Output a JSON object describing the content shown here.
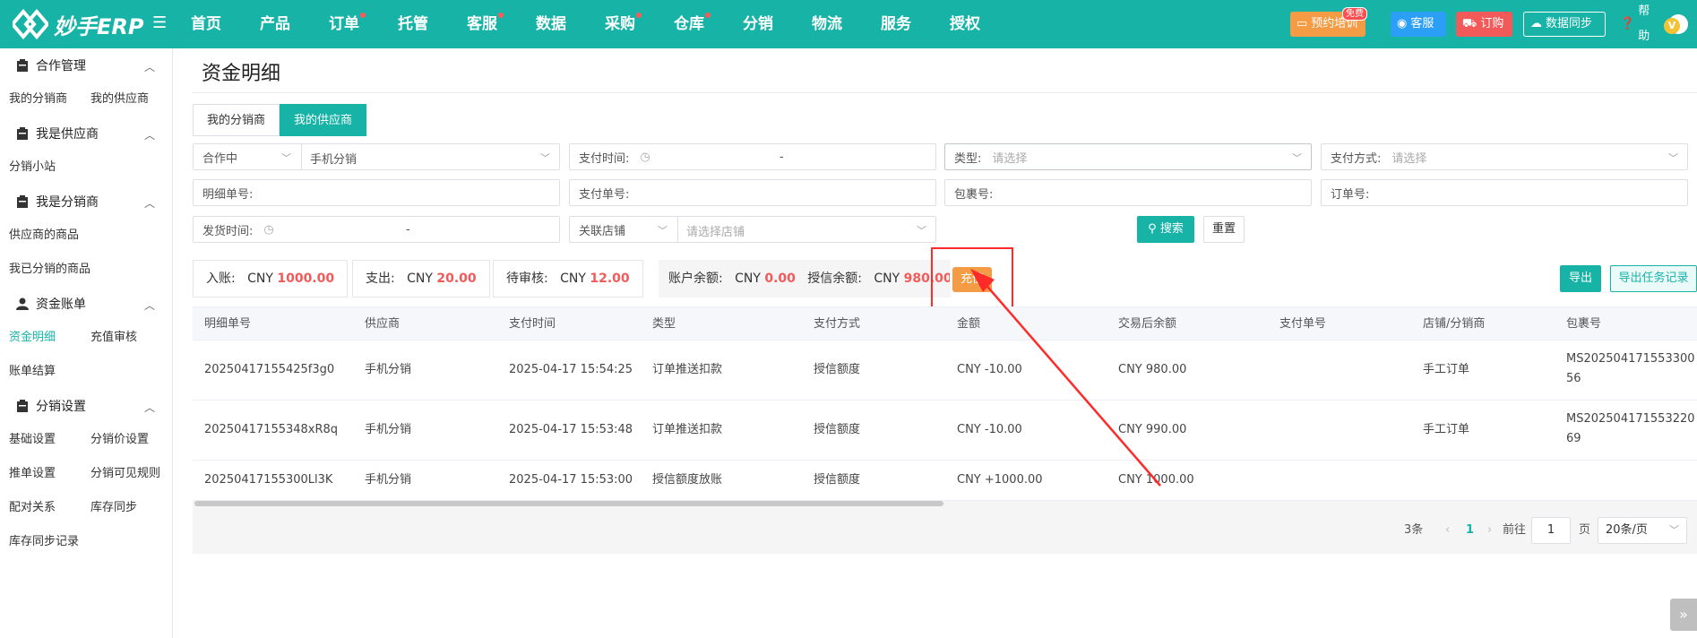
{
  "app": {
    "logo_text": "妙手ERP",
    "nav": [
      {
        "label": "首页",
        "dot": false
      },
      {
        "label": "产品",
        "dot": false
      },
      {
        "label": "订单",
        "dot": true
      },
      {
        "label": "托管",
        "dot": false
      },
      {
        "label": "客服",
        "dot": true
      },
      {
        "label": "数据",
        "dot": false
      },
      {
        "label": "采购",
        "dot": true
      },
      {
        "label": "仓库",
        "dot": true
      },
      {
        "label": "分销",
        "dot": false
      },
      {
        "label": "物流",
        "dot": false
      },
      {
        "label": "服务",
        "dot": false
      },
      {
        "label": "授权",
        "dot": false
      }
    ],
    "topbar_buttons": {
      "yuyue": "预约培训",
      "yuyue_badge": "免费",
      "kefu": "客服",
      "dinggou": "订购",
      "sync": "数据同步",
      "help": "帮助"
    },
    "avatar_letter": "V",
    "colors": {
      "brand": "#17b3a7",
      "accent_red": "#f25a5a",
      "orange": "#f39c45",
      "blue": "#2b9ef5"
    }
  },
  "sidebar": {
    "groups": [
      {
        "title": "合作管理",
        "links": [
          "我的分销商",
          "我的供应商"
        ]
      },
      {
        "title": "我是供应商",
        "links": [
          "分销小站"
        ]
      },
      {
        "title": "我是分销商",
        "links": [
          "供应商的商品",
          "我已分销的商品"
        ]
      },
      {
        "title": "资金账单",
        "links": [
          "资金明细",
          "充值审核",
          "账单结算"
        ]
      },
      {
        "title": "分销设置",
        "links": [
          "基础设置",
          "分销价设置",
          "推单设置",
          "分销可见规则",
          "配对关系",
          "库存同步",
          "库存同步记录"
        ]
      }
    ],
    "active_link": "资金明细"
  },
  "page": {
    "title": "资金明细",
    "tabs": [
      {
        "label": "我的分销商",
        "active": false
      },
      {
        "label": "我的供应商",
        "active": true
      }
    ]
  },
  "filters": {
    "status_select": "合作中",
    "partner_select": "手机分销",
    "pay_time_label": "支付时间:",
    "range_sep": "-",
    "type_label": "类型:",
    "type_placeholder": "请选择",
    "pay_method_label": "支付方式:",
    "pay_method_placeholder": "请选择",
    "detail_no_label": "明细单号:",
    "pay_no_label": "支付单号:",
    "package_no_label": "包裹号:",
    "order_no_label": "订单号:",
    "ship_time_label": "发货时间:",
    "shop_select": "关联店铺",
    "shop_placeholder": "请选择店铺",
    "search_label": "搜索",
    "reset_label": "重置"
  },
  "summary": {
    "income_label": "入账:",
    "income_currency": "CNY",
    "income_value": "1000.00",
    "expense_label": "支出:",
    "expense_currency": "CNY",
    "expense_value": "20.00",
    "pending_label": "待审核:",
    "pending_currency": "CNY",
    "pending_value": "12.00",
    "balance_label": "账户余额:",
    "balance_currency": "CNY",
    "balance_value": "0.00",
    "credit_label": "授信余额:",
    "credit_currency": "CNY",
    "credit_value": "980.00",
    "recharge_label": "充值",
    "export_label": "导出",
    "export_task_label": "导出任务记录"
  },
  "table": {
    "headers": [
      "明细单号",
      "供应商",
      "支付时间",
      "类型",
      "支付方式",
      "金额",
      "交易后余额",
      "支付单号",
      "店铺/分销商",
      "包裹号"
    ],
    "rows": [
      {
        "detail_no": "20250417155425f3g0",
        "supplier": "手机分销",
        "pay_time": "2025-04-17 15:54:25",
        "type": "订单推送扣款",
        "pay_method": "授信额度",
        "amount": "CNY -10.00",
        "balance_after": "CNY 980.00",
        "pay_no": "",
        "shop": "手工订单",
        "package_line1": "MS202504171553300",
        "package_line2": "56"
      },
      {
        "detail_no": "20250417155348xR8q",
        "supplier": "手机分销",
        "pay_time": "2025-04-17 15:53:48",
        "type": "订单推送扣款",
        "pay_method": "授信额度",
        "amount": "CNY -10.00",
        "balance_after": "CNY 990.00",
        "pay_no": "",
        "shop": "手工订单",
        "package_line1": "MS202504171553220",
        "package_line2": "69"
      },
      {
        "detail_no": "20250417155300Ll3K",
        "supplier": "手机分销",
        "pay_time": "2025-04-17 15:53:00",
        "type": "授信额度放账",
        "pay_method": "授信额度",
        "amount": "CNY +1000.00",
        "balance_after": "CNY 1000.00",
        "pay_no": "",
        "shop": "",
        "package_line1": "",
        "package_line2": ""
      }
    ]
  },
  "pagination": {
    "total": "3条",
    "current_page": "1",
    "goto_label": "前往",
    "goto_value": "1",
    "page_unit": "页",
    "page_size": "20条/页"
  }
}
